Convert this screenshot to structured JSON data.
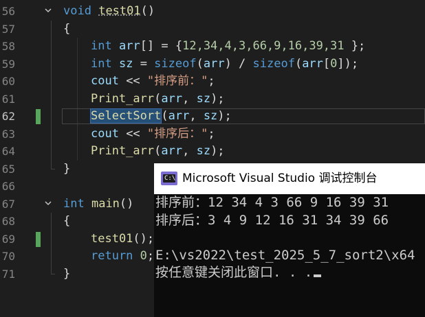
{
  "editor": {
    "lines": [
      {
        "num": "56",
        "fold": true,
        "segments": [
          {
            "t": "void",
            "c": "kw"
          },
          {
            "t": " "
          },
          {
            "t": "test01",
            "c": "fn squiggle"
          },
          {
            "t": "()"
          }
        ]
      },
      {
        "num": "57",
        "segments": [
          {
            "t": "{"
          }
        ]
      },
      {
        "num": "58",
        "segments": [
          {
            "t": "int",
            "c": "kw"
          },
          {
            "t": " "
          },
          {
            "t": "arr",
            "c": "var"
          },
          {
            "t": "[] = {"
          },
          {
            "t": "12,34,4,3,66,9,16,39,31",
            "c": "num"
          },
          {
            "t": " };"
          }
        ]
      },
      {
        "num": "59",
        "segments": [
          {
            "t": "int",
            "c": "kw"
          },
          {
            "t": " "
          },
          {
            "t": "sz",
            "c": "var"
          },
          {
            "t": " = "
          },
          {
            "t": "sizeof",
            "c": "kw"
          },
          {
            "t": "("
          },
          {
            "t": "arr",
            "c": "var"
          },
          {
            "t": ") / "
          },
          {
            "t": "sizeof",
            "c": "kw"
          },
          {
            "t": "("
          },
          {
            "t": "arr",
            "c": "var"
          },
          {
            "t": "["
          },
          {
            "t": "0",
            "c": "num"
          },
          {
            "t": "]);"
          }
        ]
      },
      {
        "num": "60",
        "segments": [
          {
            "t": "cout",
            "c": "var"
          },
          {
            "t": " << "
          },
          {
            "t": "\"排序前：\"",
            "c": "str"
          },
          {
            "t": ";"
          }
        ]
      },
      {
        "num": "61",
        "segments": [
          {
            "t": "Print_arr",
            "c": "fn"
          },
          {
            "t": "("
          },
          {
            "t": "arr",
            "c": "var"
          },
          {
            "t": ", "
          },
          {
            "t": "sz",
            "c": "var"
          },
          {
            "t": ");"
          }
        ]
      },
      {
        "num": "62",
        "current": true,
        "changed": true,
        "segments": [
          {
            "t": "SelectSort",
            "c": "fn hl"
          },
          {
            "t": "("
          },
          {
            "t": "arr",
            "c": "var"
          },
          {
            "t": ", "
          },
          {
            "t": "sz",
            "c": "var"
          },
          {
            "t": ");"
          }
        ]
      },
      {
        "num": "63",
        "segments": [
          {
            "t": "cout",
            "c": "var"
          },
          {
            "t": " << "
          },
          {
            "t": "\"排序后：\"",
            "c": "str"
          },
          {
            "t": ";"
          }
        ]
      },
      {
        "num": "64",
        "segments": [
          {
            "t": "Print_arr",
            "c": "fn"
          },
          {
            "t": "("
          },
          {
            "t": "arr",
            "c": "var"
          },
          {
            "t": ", "
          },
          {
            "t": "sz",
            "c": "var"
          },
          {
            "t": ");"
          }
        ]
      },
      {
        "num": "65",
        "segments": [
          {
            "t": "}"
          }
        ]
      },
      {
        "num": "66",
        "segments": []
      },
      {
        "num": "67",
        "fold": true,
        "segments": [
          {
            "t": "int",
            "c": "kw"
          },
          {
            "t": " "
          },
          {
            "t": "main",
            "c": "fn"
          },
          {
            "t": "()"
          }
        ]
      },
      {
        "num": "68",
        "segments": [
          {
            "t": "{"
          }
        ]
      },
      {
        "num": "69",
        "changed": true,
        "segments": [
          {
            "t": "test01",
            "c": "fn"
          },
          {
            "t": "();"
          }
        ]
      },
      {
        "num": "70",
        "segments": [
          {
            "t": "return",
            "c": "kw"
          },
          {
            "t": " "
          },
          {
            "t": "0",
            "c": "num"
          },
          {
            "t": ";"
          }
        ]
      },
      {
        "num": "71",
        "segments": [
          {
            "t": "}"
          }
        ]
      }
    ]
  },
  "console": {
    "title": "Microsoft Visual Studio 调试控制台",
    "icon_name": "console-app-icon",
    "icon_glyph": "C:\\",
    "lines": [
      "排序前：12 34 4 3 66 9 16 39 31",
      "排序后：3 4 9 12 16 31 34 39 66",
      "",
      "E:\\vs2022\\test_2025_5_7_sort2\\x64",
      "按任意键关闭此窗口. . ."
    ]
  },
  "colors": {
    "keyword": "#569cd6",
    "function": "#dcdcaa",
    "variable": "#9cdcfe",
    "string": "#d69d85",
    "number": "#b5cea8",
    "change_bar": "#58a65c",
    "selection": "#264f78"
  }
}
